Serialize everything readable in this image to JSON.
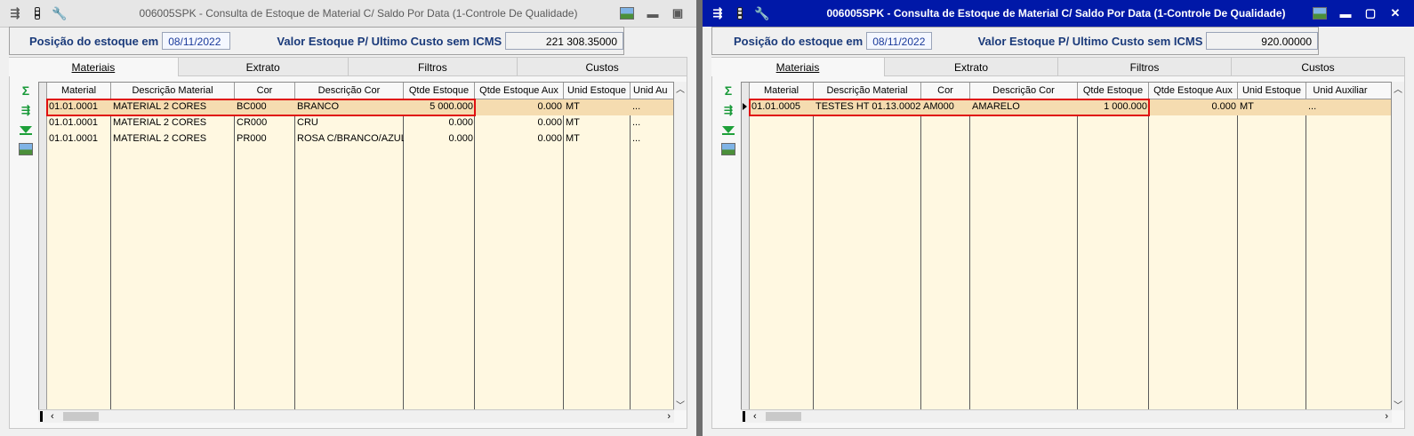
{
  "left": {
    "title": "006005SPK - Consulta de Estoque de Material C/ Saldo Por Data (1-Controle De Qualidade)",
    "position_label": "Posição do estoque em",
    "position_date": "08/11/2022",
    "value_label": "Valor Estoque P/ Ultimo Custo sem ICMS",
    "value": "221 308.35000",
    "tabs": [
      "Materiais",
      "Extrato",
      "Filtros",
      "Custos"
    ],
    "columns": [
      "Material",
      "Descrição Material",
      "Cor",
      "Descrição Cor",
      "Qtde Estoque",
      "Qtde Estoque Aux",
      "Unid Estoque",
      "Unid Au"
    ],
    "rows": [
      [
        "01.01.0001",
        "MATERIAL 2 CORES",
        "BC000",
        "BRANCO",
        "5 000.000",
        "0.000",
        "MT",
        "..."
      ],
      [
        "01.01.0001",
        "MATERIAL 2 CORES",
        "CR000",
        "CRU",
        "0.000",
        "0.000",
        "MT",
        "..."
      ],
      [
        "01.01.0001",
        "MATERIAL 2 CORES",
        "PR000",
        "ROSA C/BRANCO/AZUL/B",
        "0.000",
        "0.000",
        "MT",
        "..."
      ]
    ]
  },
  "right": {
    "title": "006005SPK - Consulta de Estoque de Material C/ Saldo Por Data (1-Controle De Qualidade)",
    "position_label": "Posição do estoque em",
    "position_date": "08/11/2022",
    "value_label": "Valor Estoque P/ Ultimo Custo sem ICMS",
    "value": "920.00000",
    "tabs": [
      "Materiais",
      "Extrato",
      "Filtros",
      "Custos"
    ],
    "columns": [
      "Material",
      "Descrição Material",
      "Cor",
      "Descrição Cor",
      "Qtde Estoque",
      "Qtde Estoque Aux",
      "Unid Estoque",
      "Unid Auxiliar"
    ],
    "rows": [
      [
        "01.01.0005",
        "TESTES HT 01.13.0002",
        "AM000",
        "AMARELO",
        "1 000.000",
        "0.000",
        "MT",
        "..."
      ]
    ]
  },
  "icons": {
    "window_menu": "window-menu-icon",
    "traffic_light": "traffic-light-icon",
    "wrench": "wrench-icon",
    "image": "image-icon",
    "minimize": "minimize-icon",
    "restore": "restore-icon",
    "close": "close-icon",
    "sum": "sum-icon",
    "export": "export-icon",
    "download": "download-icon"
  },
  "colors": {
    "grid_bg": "#fff8e1",
    "selected_row": "#f5dcb0",
    "highlight_box": "#e01010",
    "active_titlebar": "#0018a8",
    "label_blue": "#1a3a7a"
  }
}
